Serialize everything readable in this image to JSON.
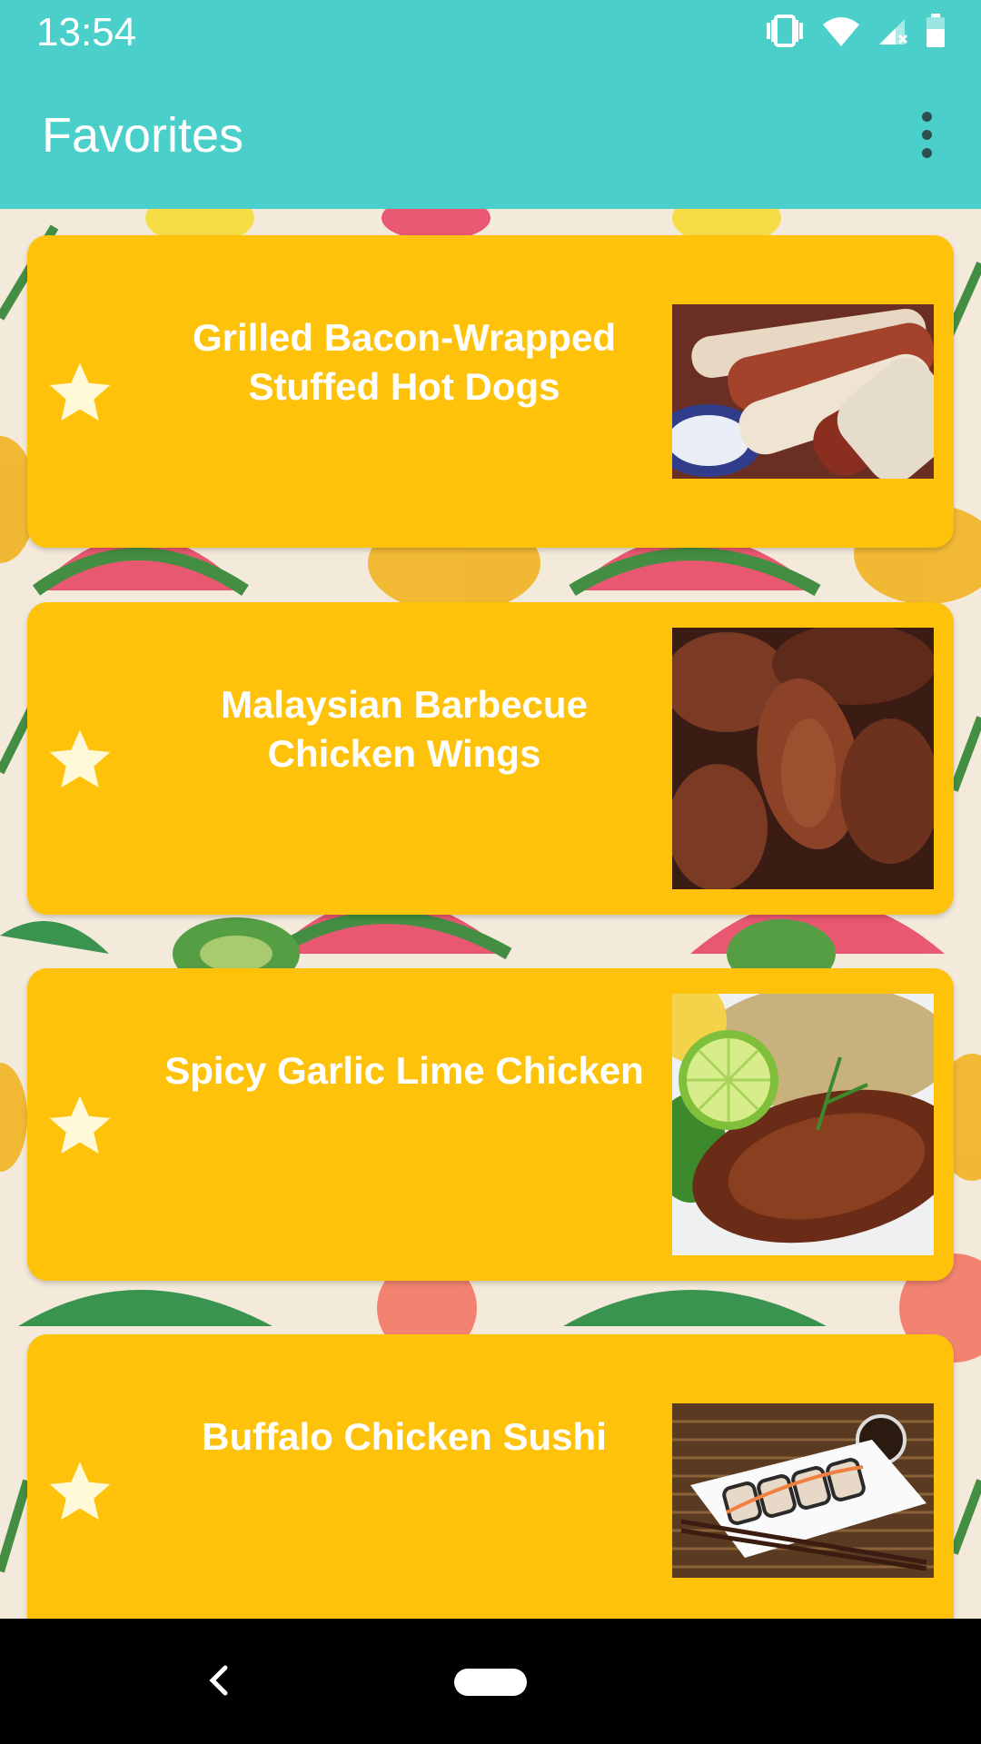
{
  "status_bar": {
    "time": "13:54",
    "icons": [
      "vibrate-icon",
      "wifi-icon",
      "signal-icon",
      "battery-icon"
    ]
  },
  "app_bar": {
    "title": "Favorites",
    "menu_icon": "more-vert-icon"
  },
  "theme": {
    "accent": "#4acfca",
    "card": "#fec20b",
    "star": "#fff9d8"
  },
  "recipes": [
    {
      "title": "Grilled Bacon-Wrapped Stuffed Hot Dogs",
      "favorite": true,
      "image": "hot-dogs-photo"
    },
    {
      "title": "Malaysian Barbecue Chicken Wings",
      "favorite": true,
      "image": "chicken-wings-photo"
    },
    {
      "title": "Spicy Garlic Lime Chicken",
      "favorite": true,
      "image": "lime-chicken-photo"
    },
    {
      "title": "Buffalo Chicken Sushi",
      "favorite": true,
      "image": "sushi-photo"
    }
  ],
  "nav_bar": {
    "icons": [
      "back-icon",
      "home-pill-icon"
    ]
  }
}
